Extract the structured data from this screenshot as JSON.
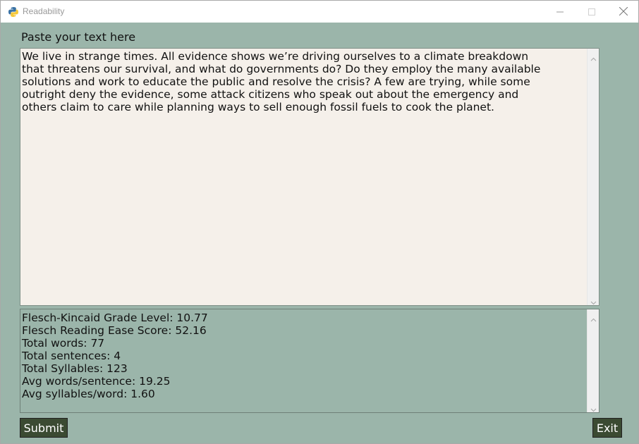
{
  "window": {
    "title": "Readability"
  },
  "prompt": {
    "label": "Paste your text here"
  },
  "input": {
    "text": "We live in strange times. All evidence shows we’re driving ourselves to a climate breakdown\nthat threatens our survival, and what do governments do? Do they employ the many available\nsolutions and work to educate the public and resolve the crisis? A few are trying, while some\noutright deny the evidence, some attack citizens who speak out about the emergency and\nothers claim to care while planning ways to sell enough fossil fuels to cook the planet."
  },
  "output": {
    "lines": [
      "Flesch-Kincaid Grade Level: 10.77",
      "Flesch Reading Ease Score: 52.16",
      "Total words: 77",
      "Total sentences: 4",
      "Total Syllables: 123",
      "Avg words/sentence: 19.25",
      "Avg syllables/word: 1.60"
    ]
  },
  "buttons": {
    "submit_label": "Submit",
    "exit_label": "Exit"
  },
  "colors": {
    "window_bg": "#9bb5aa",
    "input_bg": "#f5f0ea",
    "button_bg": "#3b4a32"
  },
  "icons": {
    "app": "python-logo-icon",
    "minimize": "minimize-icon",
    "maximize": "maximize-icon",
    "close": "close-icon"
  }
}
